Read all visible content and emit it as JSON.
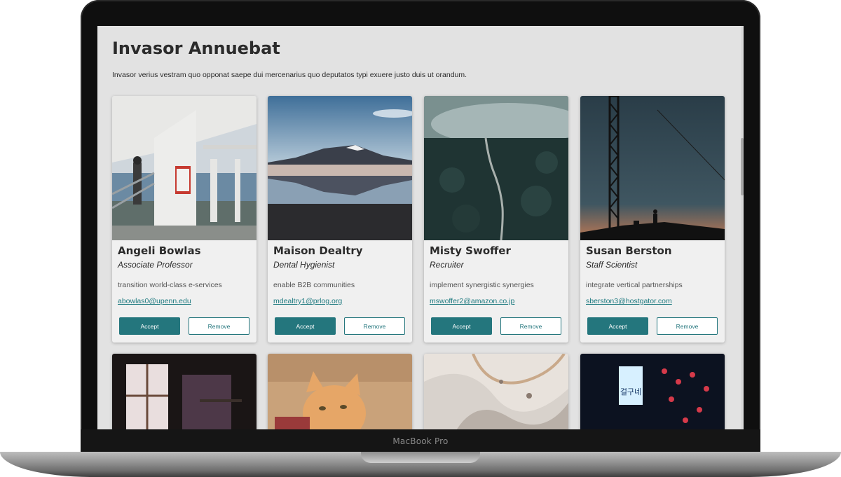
{
  "page": {
    "title": "Invasor Annuebat",
    "description": "Invasor verius vestram quo opponat saepe dui mercenarius quo deputatos typi exuere justo duis ut orandum."
  },
  "device": {
    "label": "MacBook Pro"
  },
  "colors": {
    "accent": "#24767d",
    "email": "#1e7a80",
    "background": "#e2e2e2"
  },
  "buttons": {
    "accept": "Accept",
    "remove": "Remove"
  },
  "cards": [
    {
      "name": "Angeli Bowlas",
      "title": "Associate Professor",
      "tagline": "transition world-class e-services",
      "email": "abowlas0@upenn.edu",
      "photo": "ferry-deck-photo"
    },
    {
      "name": "Maison Dealtry",
      "title": "Dental Hygienist",
      "tagline": "enable B2B communities",
      "email": "mdealtry1@prlog.org",
      "photo": "mountain-lake-photo"
    },
    {
      "name": "Misty Swoffer",
      "title": "Recruiter",
      "tagline": "implement synergistic synergies",
      "email": "mswoffer2@amazon.co.jp",
      "photo": "misty-forest-photo"
    },
    {
      "name": "Susan Berston",
      "title": "Staff Scientist",
      "tagline": "integrate vertical partnerships",
      "email": "sberston3@hostgator.com",
      "photo": "tower-silhouette-photo"
    }
  ],
  "second_row_photos": [
    "window-room-photo",
    "cat-photo",
    "marble-texture-photo",
    "neon-street-photo"
  ],
  "neon_sign_text": "걸구네"
}
